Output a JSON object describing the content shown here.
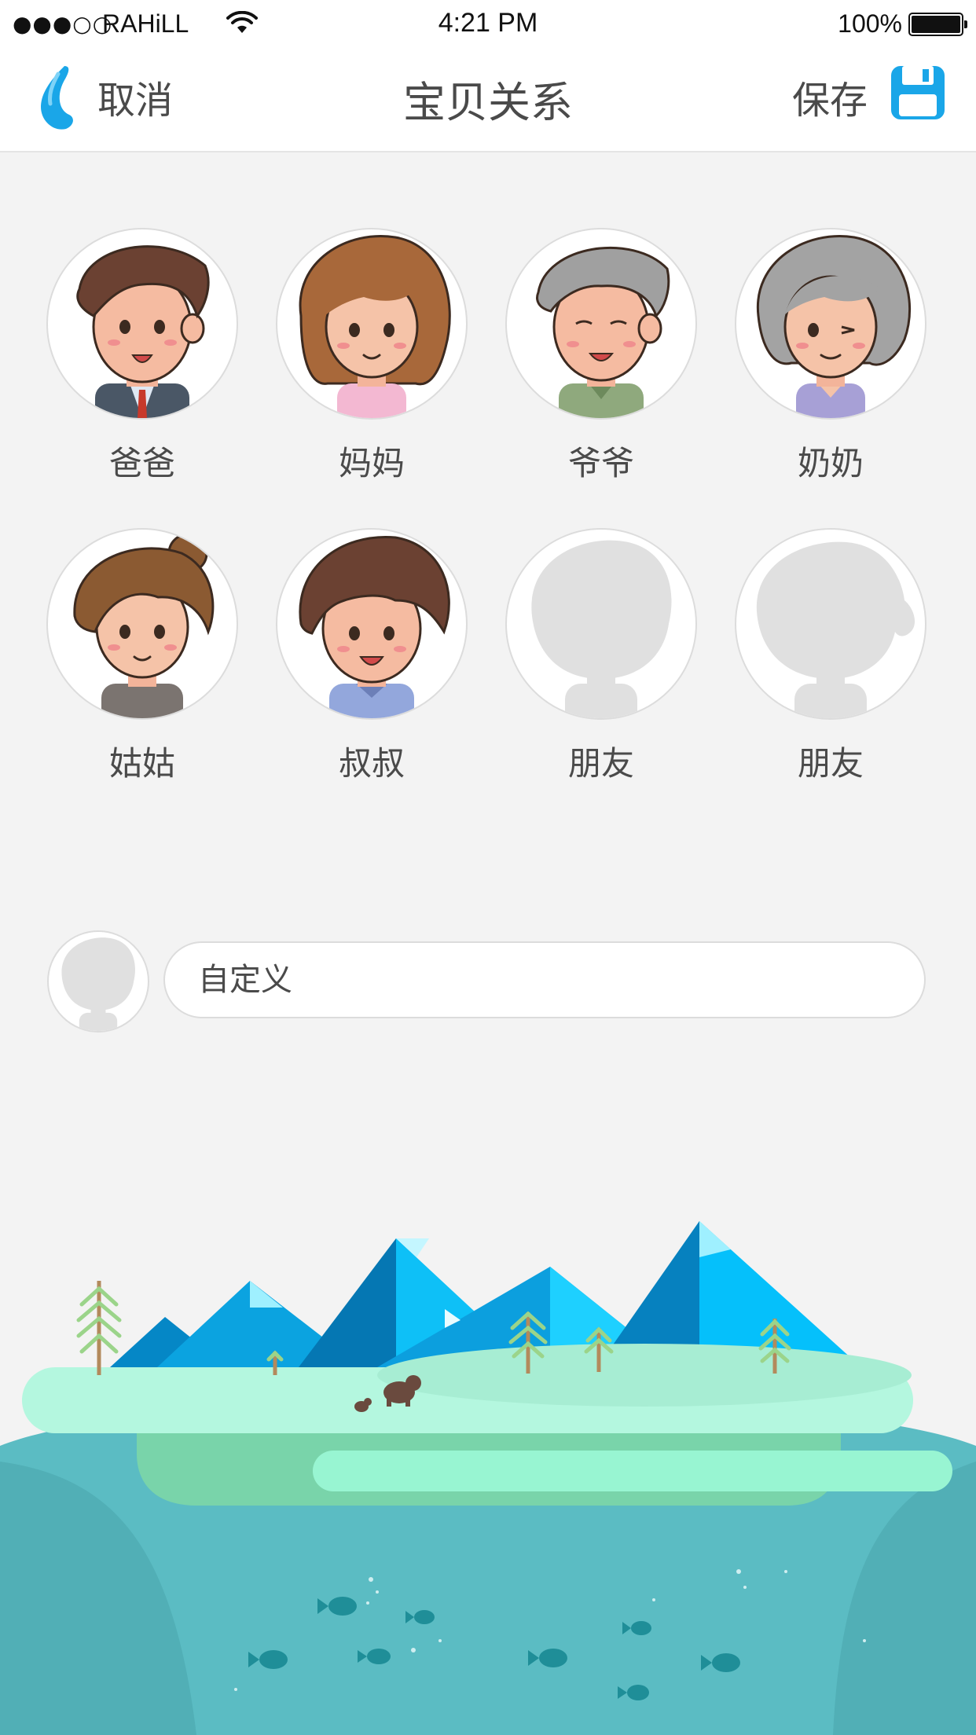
{
  "status_bar": {
    "signal": "●●●○○",
    "carrier": "RAHiLL",
    "time": "4:21 PM",
    "battery": "100%"
  },
  "nav": {
    "cancel_label": "取消",
    "title": "宝贝关系",
    "save_label": "保存"
  },
  "relations": [
    {
      "label": "爸爸",
      "avatar": "dad-avatar"
    },
    {
      "label": "妈妈",
      "avatar": "mom-avatar"
    },
    {
      "label": "爷爷",
      "avatar": "grandpa-avatar"
    },
    {
      "label": "奶奶",
      "avatar": "grandma-avatar"
    },
    {
      "label": "姑姑",
      "avatar": "aunt-avatar"
    },
    {
      "label": "叔叔",
      "avatar": "uncle-avatar"
    },
    {
      "label": "朋友",
      "avatar": "friend-male-silhouette"
    },
    {
      "label": "朋友",
      "avatar": "friend-female-silhouette"
    }
  ],
  "custom": {
    "placeholder": "自定义"
  },
  "colors": {
    "accent": "#1aa6e8",
    "background": "#f3f3f3",
    "text": "#4a4a4a",
    "water": "#5bbcc3",
    "mountain_light": "#0ec0f7",
    "mountain_dark": "#0587c6"
  }
}
